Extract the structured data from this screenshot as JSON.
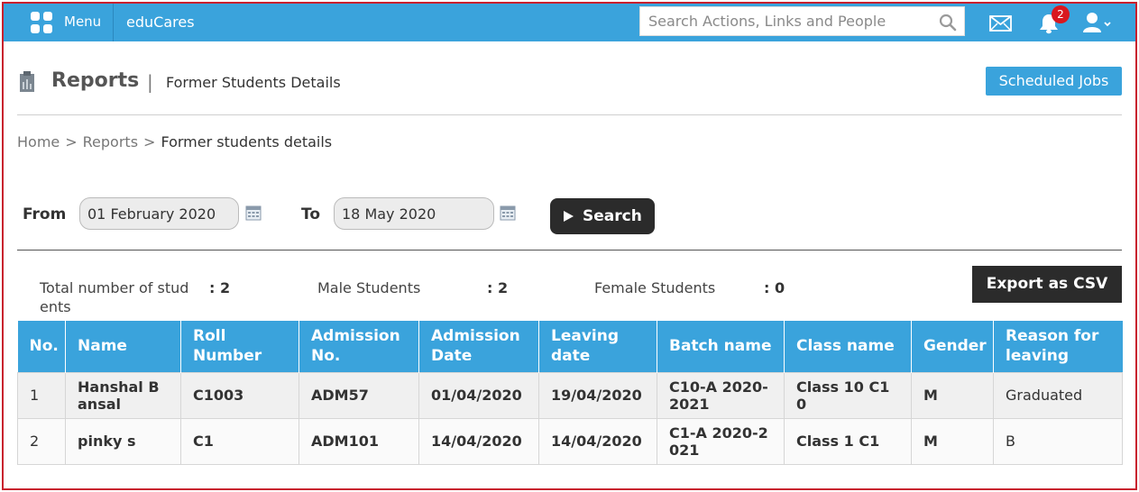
{
  "topbar": {
    "menu_label": "Menu",
    "brand": "eduCares",
    "search_placeholder": "Search Actions, Links and People",
    "notification_count": "2"
  },
  "header": {
    "title": "Reports",
    "separator": "|",
    "subtitle": "Former Students Details",
    "scheduled_jobs_label": "Scheduled Jobs"
  },
  "breadcrumb": {
    "items": [
      "Home",
      "Reports",
      "Former students details"
    ],
    "separator": ">"
  },
  "filter": {
    "from_label": "From",
    "from_value": "01 February 2020",
    "to_label": "To",
    "to_value": "18 May 2020",
    "search_label": "Search"
  },
  "stats": {
    "total_label": "Total number of stud ents",
    "total_value": ": 2",
    "male_label": "Male Students",
    "male_value": ": 2",
    "female_label": "Female Students",
    "female_value": ": 0"
  },
  "export_label": "Export as CSV",
  "table": {
    "headers": [
      "No.",
      "Name",
      "Roll Number",
      "Admission No.",
      "Admission Date",
      "Leaving date",
      "Batch name",
      "Class name",
      "Gender",
      "Reason for leaving"
    ],
    "rows": [
      [
        "1",
        "Hanshal Bansal",
        "C1003",
        "ADM57",
        "01/04/2020",
        "19/04/2020",
        "C10-A 2020-2021",
        "Class 10 C10",
        "M",
        "Graduated"
      ],
      [
        "2",
        "pinky s",
        "C1",
        "ADM101",
        "14/04/2020",
        "14/04/2020",
        "C1-A 2020-2021",
        "Class 1 C1",
        "M",
        "B"
      ]
    ]
  },
  "colors": {
    "accent": "#3aa3dc",
    "dark_button": "#2b2b2b",
    "badge": "#d9181f",
    "frame": "#c8202e"
  }
}
